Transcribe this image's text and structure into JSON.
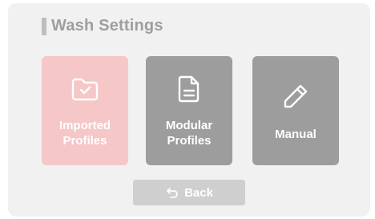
{
  "screen": {
    "title": "Wash Settings"
  },
  "tiles": [
    {
      "label": "Imported\nProfiles",
      "icon": "folder-check-icon",
      "color": "#f5c7c7"
    },
    {
      "label": "Modular\nProfiles",
      "icon": "document-icon",
      "color": "#9d9d9d"
    },
    {
      "label": "Manual",
      "icon": "pencil-icon",
      "color": "#9d9d9d"
    }
  ],
  "back": {
    "label": "Back",
    "icon": "undo-arrow-icon"
  }
}
